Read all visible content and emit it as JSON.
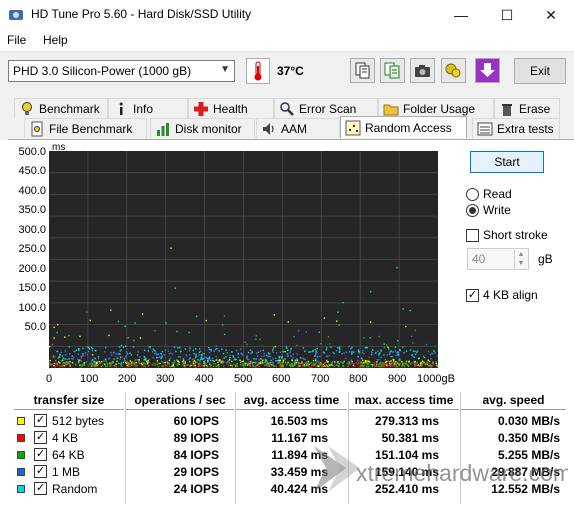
{
  "window": {
    "title": "HD Tune Pro 5.60 - Hard Disk/SSD Utility",
    "minimize": "—",
    "maximize": "☐",
    "close": "✕"
  },
  "menu": {
    "file": "File",
    "help": "Help"
  },
  "toolbar": {
    "drive": "PHD 3.0 Silicon-Power (1000 gB)",
    "temperature": "37°C",
    "exit_label": "Exit",
    "icons": [
      "copy-info-icon",
      "copy-text-icon",
      "screenshot-camera-icon",
      "options-icon",
      "download-icon"
    ]
  },
  "tabs_row1": [
    {
      "label": "Benchmark",
      "icon": "lightbulb-icon"
    },
    {
      "label": "Info",
      "icon": "info-icon"
    },
    {
      "label": "Health",
      "icon": "health-cross-icon"
    },
    {
      "label": "Error Scan",
      "icon": "magnifier-icon"
    },
    {
      "label": "Folder Usage",
      "icon": "folder-icon"
    },
    {
      "label": "Erase",
      "icon": "trash-icon"
    }
  ],
  "tabs_row2": [
    {
      "label": "File Benchmark",
      "icon": "file-benchmark-icon"
    },
    {
      "label": "Disk monitor",
      "icon": "disk-monitor-icon"
    },
    {
      "label": "AAM",
      "icon": "speaker-icon"
    },
    {
      "label": "Random Access",
      "icon": "random-access-icon",
      "active": true
    },
    {
      "label": "Extra tests",
      "icon": "extra-tests-icon"
    }
  ],
  "controls": {
    "start_label": "Start",
    "read_label": "Read",
    "write_label": "Write",
    "mode_selected": "Write",
    "short_stroke_label": "Short stroke",
    "short_stroke_checked": false,
    "short_stroke_value": "40",
    "short_stroke_unit": "gB",
    "align_label": "4 KB align",
    "align_checked": true
  },
  "chart_data": {
    "type": "scatter",
    "ylabel": "ms",
    "ylim": [
      0,
      500
    ],
    "yticks": [
      "500.0",
      "450.0",
      "400.0",
      "350.0",
      "300.0",
      "250.0",
      "200.0",
      "150.0",
      "100.0",
      "50.0"
    ],
    "xlim": [
      0,
      1000
    ],
    "xticks": [
      "0",
      "100",
      "200",
      "300",
      "400",
      "500",
      "600",
      "700",
      "800",
      "900",
      "1000gB"
    ],
    "grid": true,
    "series": [
      {
        "name": "512 bytes",
        "color": "#ffff00",
        "typical_ms": 16.5,
        "max_ms": 279.3
      },
      {
        "name": "4 KB",
        "color": "#ff2020",
        "typical_ms": 11.2,
        "max_ms": 50.4
      },
      {
        "name": "64 KB",
        "color": "#00cc00",
        "typical_ms": 11.9,
        "max_ms": 151.1
      },
      {
        "name": "1 MB",
        "color": "#3c78ff",
        "typical_ms": 33.5,
        "max_ms": 159.1
      },
      {
        "name": "Random",
        "color": "#00e0e0",
        "typical_ms": 40.4,
        "max_ms": 252.4
      }
    ]
  },
  "table": {
    "headers": [
      "transfer size",
      "operations / sec",
      "avg. access time",
      "max. access time",
      "avg. speed"
    ],
    "rows": [
      {
        "name": "512 bytes",
        "color": "#ffff00",
        "ops": "60 IOPS",
        "avg": "16.503 ms",
        "max": "279.313 ms",
        "speed": "0.030 MB/s"
      },
      {
        "name": "4 KB",
        "color": "#ff0000",
        "ops": "89 IOPS",
        "avg": "11.167 ms",
        "max": "50.381 ms",
        "speed": "0.350 MB/s"
      },
      {
        "name": "64 KB",
        "color": "#00b000",
        "ops": "84 IOPS",
        "avg": "11.894 ms",
        "max": "151.104 ms",
        "speed": "5.255 MB/s"
      },
      {
        "name": "1 MB",
        "color": "#2060e0",
        "ops": "29 IOPS",
        "avg": "33.459 ms",
        "max": "159.140 ms",
        "speed": "29.887 MB/s"
      },
      {
        "name": "Random",
        "color": "#00d8e0",
        "ops": "24 IOPS",
        "avg": "40.424 ms",
        "max": "252.410 ms",
        "speed": "12.552 MB/s"
      }
    ]
  },
  "watermark": {
    "text": "xtremehardware.com"
  }
}
